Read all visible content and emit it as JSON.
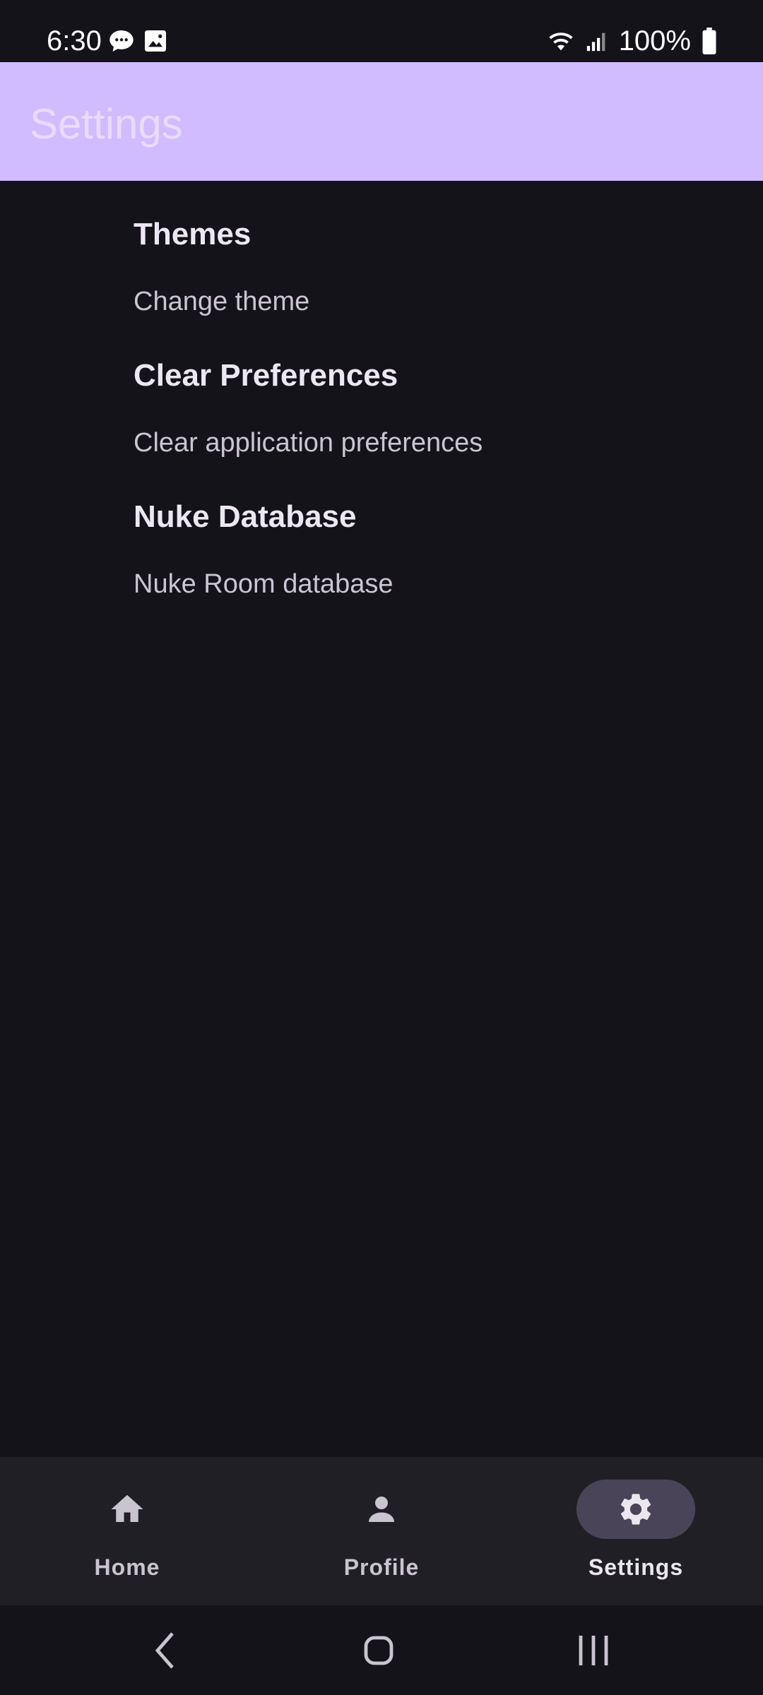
{
  "status_bar": {
    "time": "6:30",
    "battery": "100%",
    "icons": [
      "chat-bubble-icon",
      "image-icon",
      "wifi-icon",
      "signal-icon",
      "battery-icon"
    ]
  },
  "app_bar": {
    "title": "Settings",
    "background": "#d0bcff"
  },
  "settings": {
    "items": [
      {
        "title": "Themes",
        "subtitle": "Change theme"
      },
      {
        "title": "Clear Preferences",
        "subtitle": "Clear application preferences"
      },
      {
        "title": "Nuke Database",
        "subtitle": "Nuke Room database"
      }
    ]
  },
  "bottom_nav": {
    "items": [
      {
        "label": "Home",
        "icon": "home-icon",
        "active": false
      },
      {
        "label": "Profile",
        "icon": "person-icon",
        "active": false
      },
      {
        "label": "Settings",
        "icon": "gear-icon",
        "active": true
      }
    ],
    "active_indicator_color": "#4a4458"
  },
  "system_nav": {
    "icons": [
      "back-icon",
      "home-circle-icon",
      "recents-icon"
    ]
  },
  "colors": {
    "background": "#15131a",
    "nav_background": "#211f26",
    "primary": "#d0bcff"
  }
}
